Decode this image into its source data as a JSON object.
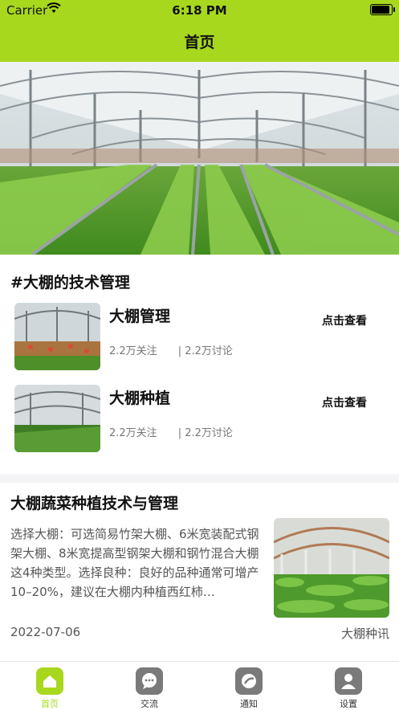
{
  "status_bar": {
    "carrier": "Carrier",
    "time": "6:18 PM"
  },
  "header": {
    "title": "首页"
  },
  "tech_section": {
    "title": "#大棚的技术管理",
    "items": [
      {
        "name": "大棚管理",
        "followers": "2.2万关注",
        "discussions": "| 2.2万讨论",
        "action": "点击查看"
      },
      {
        "name": "大棚种植",
        "followers": "2.2万关注",
        "discussions": "| 2.2万讨论",
        "action": "点击查看"
      }
    ]
  },
  "article": {
    "title": "大棚蔬菜种植技术与管理",
    "body": "选择大棚：可选简易竹架大棚、6米宽装配式钢架大棚、8米宽提高型钢架大棚和钢竹混合大棚这4种类型。选择良种：良好的品种通常可增产10–20%，建议在大棚内种植西红柿…",
    "date": "2022-07-06",
    "tag": "大棚种讯"
  },
  "tabbar": {
    "tabs": [
      {
        "label": "首页",
        "icon": "home-icon",
        "active": true
      },
      {
        "label": "交流",
        "icon": "chat-icon",
        "active": false
      },
      {
        "label": "通知",
        "icon": "notification-icon",
        "active": false
      },
      {
        "label": "设置",
        "icon": "user-settings-icon",
        "active": false
      }
    ]
  },
  "colors": {
    "accent": "#a8d81e",
    "tab_inactive": "#7a7a7a"
  }
}
